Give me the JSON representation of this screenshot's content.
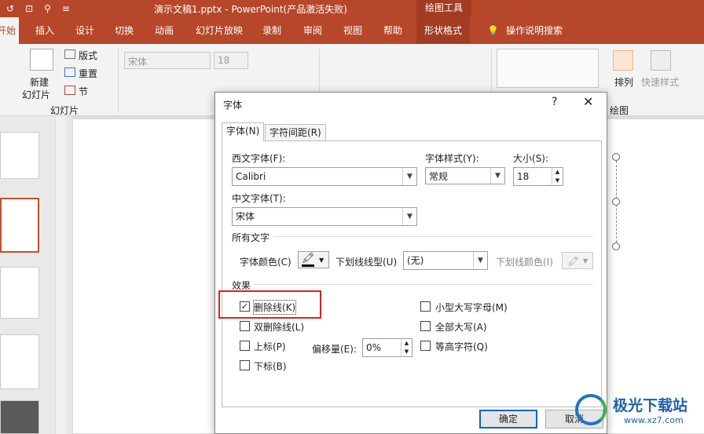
{
  "titlebar": {
    "title": "演示文稿1.pptx  -  PowerPoint(产品激活失败)",
    "context_group": "绘图工具",
    "quick_access": [
      "↺",
      "⊡",
      "⚲",
      "≡"
    ]
  },
  "tabs": [
    "开始",
    "插入",
    "设计",
    "切换",
    "动画",
    "幻灯片放映",
    "录制",
    "审阅",
    "视图",
    "帮助",
    "形状格式",
    "操作说明搜索"
  ],
  "ribbon": {
    "new_slide_l1": "新建",
    "new_slide_l2": "幻灯片",
    "layout": "版式",
    "reset": "重置",
    "section": "节",
    "group_slides": "幻灯片",
    "font_box": "宋体",
    "size_box": "18",
    "arrange": "排列",
    "quick_styles": "快速样式",
    "group_drawing": "绘图"
  },
  "dialog": {
    "title": "字体",
    "help": "?",
    "close": "✕",
    "tab_font": "字体(N)",
    "tab_spacing": "字符间距(R)",
    "latin_font_label": "西文字体(F):",
    "latin_font_value": "Calibri",
    "style_label": "字体样式(Y):",
    "style_value": "常规",
    "size_label": "大小(S):",
    "size_value": "18",
    "asian_font_label": "中文字体(T):",
    "asian_font_value": "宋体",
    "all_text_header": "所有文字",
    "font_color_label": "字体颜色(C)",
    "underline_style_label": "下划线线型(U)",
    "underline_style_value": "(无)",
    "underline_color_label": "下划线颜色(I)",
    "effects_header": "效果",
    "strikethrough": "删除线(K)",
    "double_strikethrough": "双删除线(L)",
    "superscript": "上标(P)",
    "subscript": "下标(B)",
    "offset_label": "偏移量(E):",
    "offset_value": "0%",
    "small_caps": "小型大写字母(M)",
    "all_caps": "全部大写(A)",
    "equalize_height": "等高字符(Q)",
    "ok": "确定",
    "cancel": "取消"
  },
  "checkbox_states": {
    "strikethrough": true,
    "double_strikethrough": false,
    "superscript": false,
    "subscript": false,
    "small_caps": false,
    "all_caps": false,
    "equalize_height": false
  },
  "watermark": {
    "text": "极光下载站",
    "url": "www.xz7.com"
  },
  "colors": {
    "accent": "#b7472a",
    "highlight": "#e0201b",
    "primary_button": "#0a64c8"
  }
}
